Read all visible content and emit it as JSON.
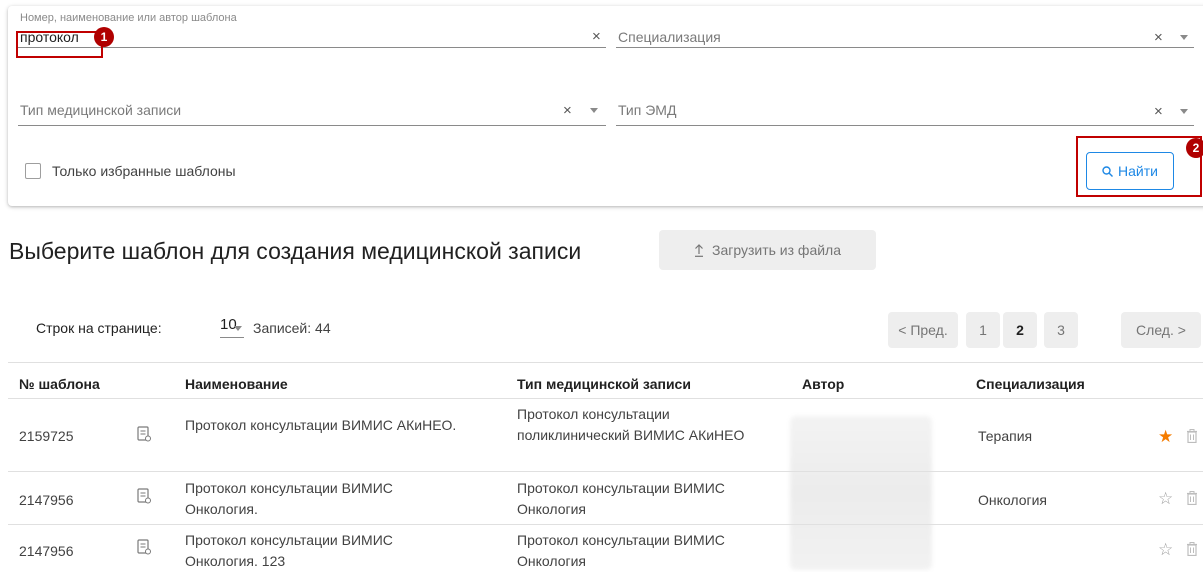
{
  "filters": {
    "search": {
      "label": "Номер, наименование или автор шаблона",
      "value": "протокол",
      "clear": "×"
    },
    "specialization": {
      "placeholder": "Специализация",
      "clear": "×"
    },
    "record_type": {
      "placeholder": "Тип медицинской записи",
      "clear": "×"
    },
    "emd_type": {
      "placeholder": "Тип ЭМД",
      "clear": "×"
    },
    "favorites_only": {
      "label": "Только избранные шаблоны",
      "checked": false
    },
    "find_button": {
      "label": "Найти",
      "icon": "search-icon"
    }
  },
  "markers": {
    "m1": "1",
    "m2": "2"
  },
  "page": {
    "title": "Выберите шаблон для создания медицинской записи",
    "upload_button": {
      "label": "Загрузить из файла",
      "icon": "upload-icon"
    }
  },
  "pagination": {
    "rows_label": "Строк на странице:",
    "rows_value": "10",
    "records_label": "Записей: 44",
    "prev": "< Пред.",
    "pages": [
      "1",
      "2",
      "3"
    ],
    "active_page": "2",
    "next": "След. >"
  },
  "table": {
    "headers": [
      "№ шаблона",
      "Наименование",
      "Тип медицинской записи",
      "Автор",
      "Специализация"
    ],
    "rows": [
      {
        "number": "2159725",
        "name": "Протокол консультации ВИМИС АКиНЕО.",
        "record_type": "Протокол консультации поликлинический ВИМИС АКиНЕО",
        "author": "",
        "specialization": "Терапия",
        "favorite": true
      },
      {
        "number": "2147956",
        "name": "Протокол консультации ВИМИС Онкология.",
        "record_type": "Протокол консультации ВИМИС Онкология",
        "author": "",
        "specialization": "Онкология",
        "favorite": false
      },
      {
        "number": "2147956",
        "name": "Протокол консультации ВИМИС Онкология. 123",
        "record_type": "Протокол консультации ВИМИС Онкология",
        "author": "",
        "specialization": "",
        "favorite": false
      }
    ]
  },
  "colors": {
    "accent": "#1e88e5",
    "highlight": "#c00000",
    "star_active": "#f57c00"
  }
}
